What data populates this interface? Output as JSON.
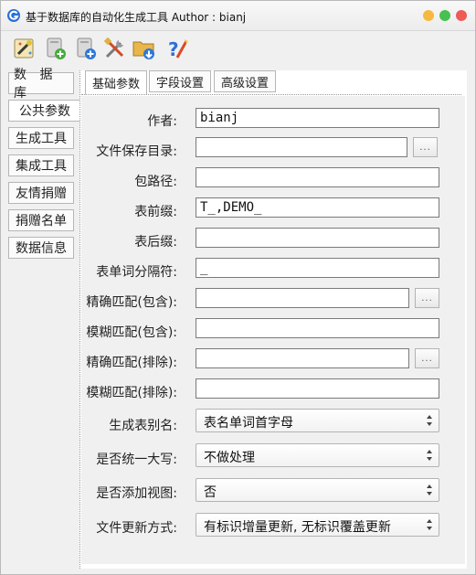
{
  "window": {
    "title": "基于数据库的自动化生成工具  Author : bianj",
    "controls": {
      "min_color": "#f5b941",
      "max_color": "#47c14f",
      "close_color": "#ee5a55"
    }
  },
  "toolbar": [
    {
      "name": "wizard-icon"
    },
    {
      "name": "add-db-icon"
    },
    {
      "name": "add-file-icon"
    },
    {
      "name": "tools-icon"
    },
    {
      "name": "folder-download-icon"
    },
    {
      "name": "help-icon"
    }
  ],
  "left_tabs": [
    {
      "label": "数 据 库",
      "active": false
    },
    {
      "label": "公共参数",
      "active": true
    },
    {
      "label": "生成工具",
      "active": false
    },
    {
      "label": "集成工具",
      "active": false
    },
    {
      "label": "友情捐赠",
      "active": false
    },
    {
      "label": "捐赠名单",
      "active": false
    },
    {
      "label": "数据信息",
      "active": false
    }
  ],
  "top_tabs": [
    {
      "label": "基础参数",
      "active": true
    },
    {
      "label": "字段设置",
      "active": false
    },
    {
      "label": "高级设置",
      "active": false
    }
  ],
  "form": {
    "author": {
      "label": "作者:",
      "value": "bianj"
    },
    "save_dir": {
      "label": "文件保存目录:",
      "value": "",
      "browse": "..."
    },
    "package": {
      "label": "包路径:",
      "value": ""
    },
    "table_prefix": {
      "label": "表前缀:",
      "value": "T_,DEMO_"
    },
    "table_suffix": {
      "label": "表后缀:",
      "value": ""
    },
    "word_separator": {
      "label": "表单词分隔符:",
      "value": "_"
    },
    "exact_include": {
      "label": "精确匹配(包含):",
      "value": "",
      "browse": "..."
    },
    "fuzzy_include": {
      "label": "模糊匹配(包含):",
      "value": ""
    },
    "exact_exclude": {
      "label": "精确匹配(排除):",
      "value": "",
      "browse": "..."
    },
    "fuzzy_exclude": {
      "label": "模糊匹配(排除):",
      "value": ""
    },
    "alias": {
      "label": "生成表别名:",
      "value": "表名单词首字母"
    },
    "uppercase": {
      "label": "是否统一大写:",
      "value": "不做处理"
    },
    "add_view": {
      "label": "是否添加视图:",
      "value": "否"
    },
    "update_mode": {
      "label": "文件更新方式:",
      "value": "有标识增量更新, 无标识覆盖更新"
    }
  }
}
